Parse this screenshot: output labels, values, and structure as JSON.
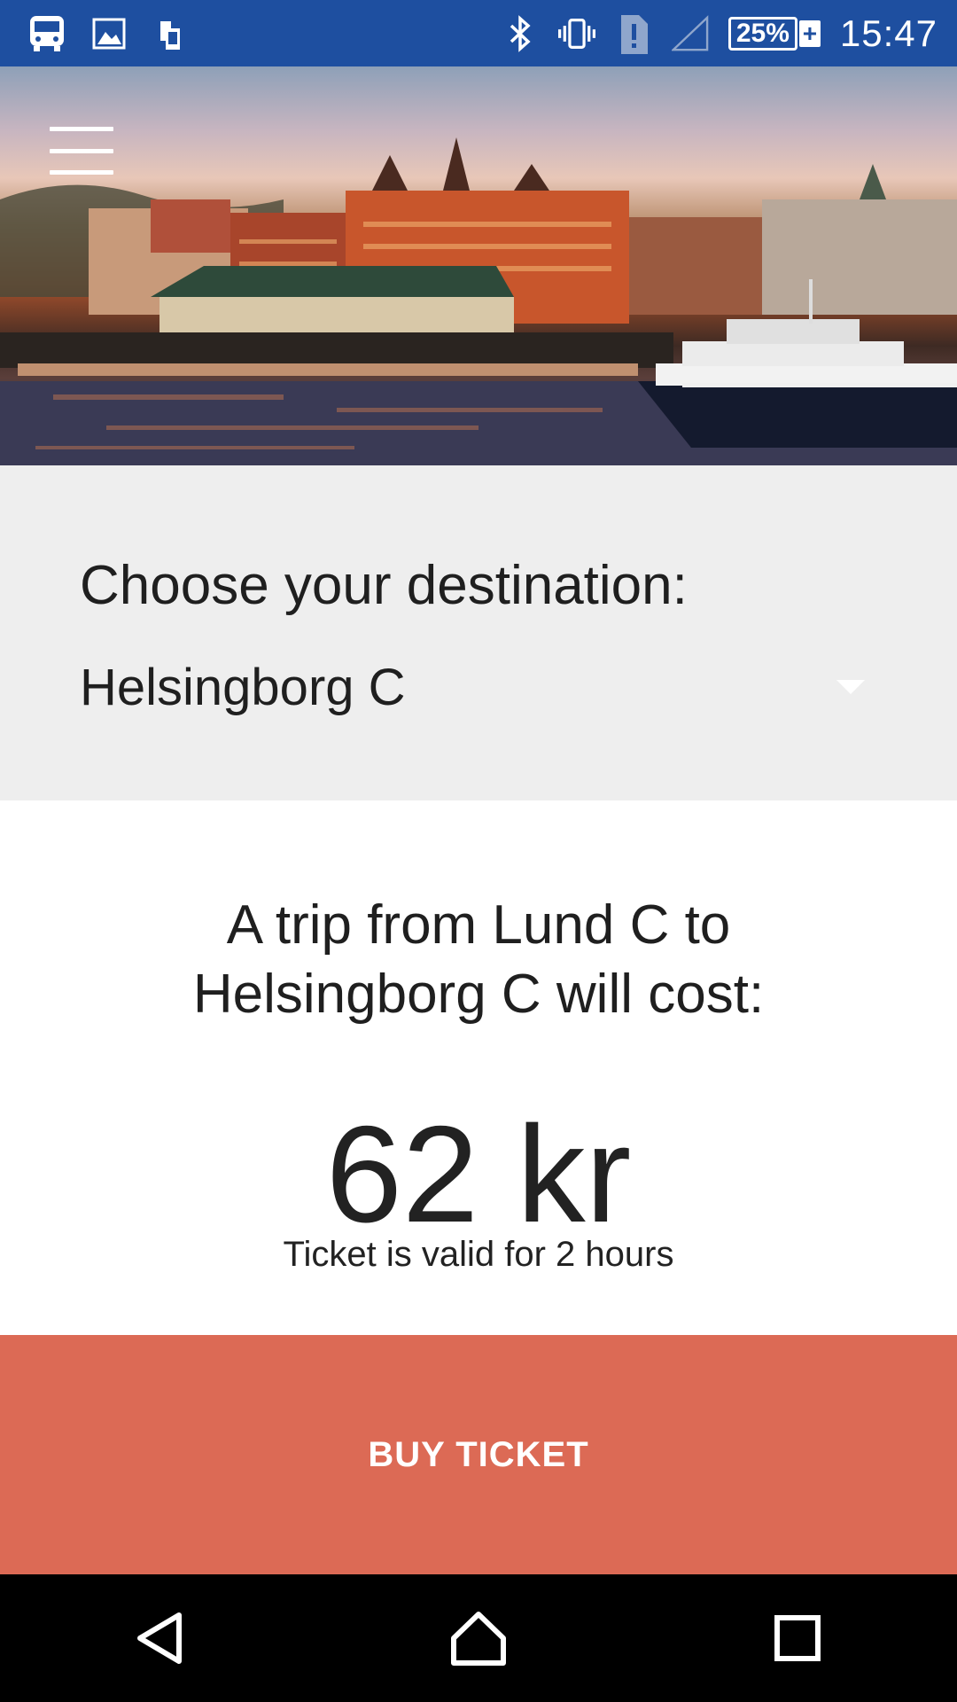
{
  "status_bar": {
    "time": "15:47",
    "battery_percent": "25%",
    "battery_charging_symbol": "+",
    "left_icons": [
      "bus-icon",
      "image-icon",
      "phone-icon"
    ],
    "right_icons": [
      "bluetooth-icon",
      "vibrate-icon",
      "sim-alert-icon",
      "signal-icon"
    ],
    "background_color": "#1e4fa0"
  },
  "hero": {
    "menu_icon": "hamburger-menu-icon"
  },
  "destination": {
    "label": "Choose your destination:",
    "selected": "Helsingborg C"
  },
  "trip": {
    "description": "A trip from Lund C to Helsingborg C will cost:",
    "price": "62 kr",
    "validity": "Ticket is valid for 2 hours"
  },
  "buy_button": {
    "label": "BUY TICKET",
    "color": "#dc6a55"
  },
  "nav_bar": {
    "icons": [
      "back-icon",
      "home-icon",
      "recents-icon"
    ]
  }
}
